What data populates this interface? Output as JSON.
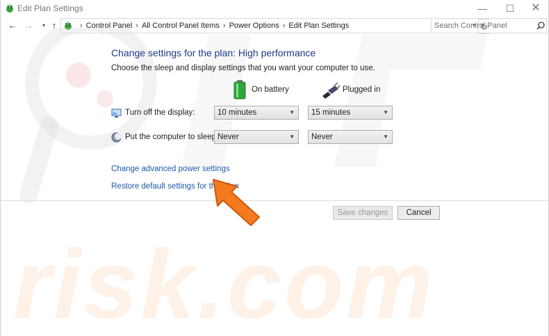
{
  "window": {
    "title": "Edit Plan Settings",
    "controls": {
      "minimize": "—",
      "maximize": "☐",
      "close": "✕"
    }
  },
  "navbar": {
    "breadcrumbs": [
      "Control Panel",
      "All Control Panel Items",
      "Power Options",
      "Edit Plan Settings"
    ],
    "search_placeholder": "Search Control Panel"
  },
  "page": {
    "title": "Change settings for the plan: High performance",
    "subtitle": "Choose the sleep and display settings that you want your computer to use."
  },
  "columns": {
    "battery": "On battery",
    "plugged": "Plugged in"
  },
  "settings": {
    "display": {
      "label": "Turn off the display:",
      "on_battery": "10 minutes",
      "plugged_in": "15 minutes"
    },
    "sleep": {
      "label": "Put the computer to sleep:",
      "on_battery": "Never",
      "plugged_in": "Never"
    }
  },
  "links": {
    "advanced": "Change advanced power settings",
    "restore": "Restore default settings for this plan"
  },
  "buttons": {
    "save": "Save changes",
    "cancel": "Cancel"
  },
  "watermark": {
    "text": "risk.com"
  },
  "colors": {
    "title_blue": "#1c3a8a",
    "link_blue": "#1a5aa8",
    "arrow_orange": "#f47a20"
  }
}
